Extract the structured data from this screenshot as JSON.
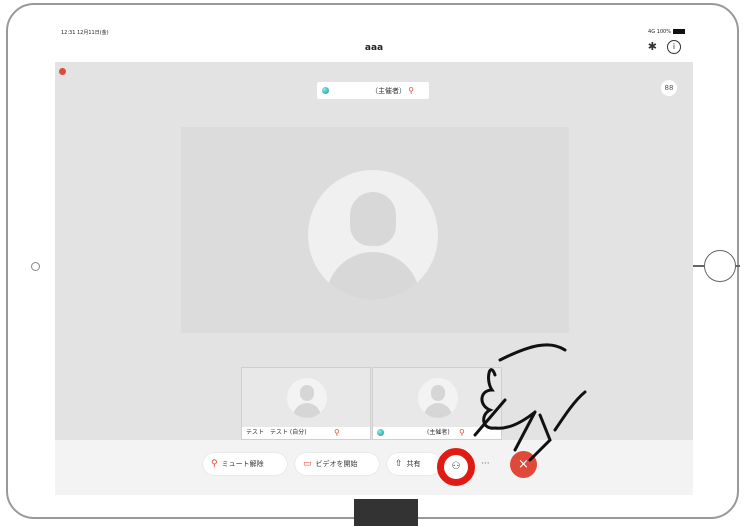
{
  "status": {
    "time": "12:31  12月11日(金)",
    "signal": "4G 100%"
  },
  "nav": {
    "title": "aaa",
    "bluetooth_icon": "bluetooth-icon",
    "info_icon": "info-icon",
    "info_glyph": "i"
  },
  "stage": {
    "speaker_name": "（主催者）",
    "grid_label": "88"
  },
  "thumbnails": [
    {
      "name": "テスト　テスト (自分)"
    },
    {
      "name": "(主催者)"
    }
  ],
  "toolbar": {
    "unmute_label": "ミュート解除",
    "video_label": "ビデオを開始",
    "share_label": "共有",
    "participants_icon": "participants-icon",
    "more_label": "···",
    "end_label": "×"
  },
  "colors": {
    "accent_red": "#e04a3a",
    "highlight_ring": "#e01b14"
  }
}
